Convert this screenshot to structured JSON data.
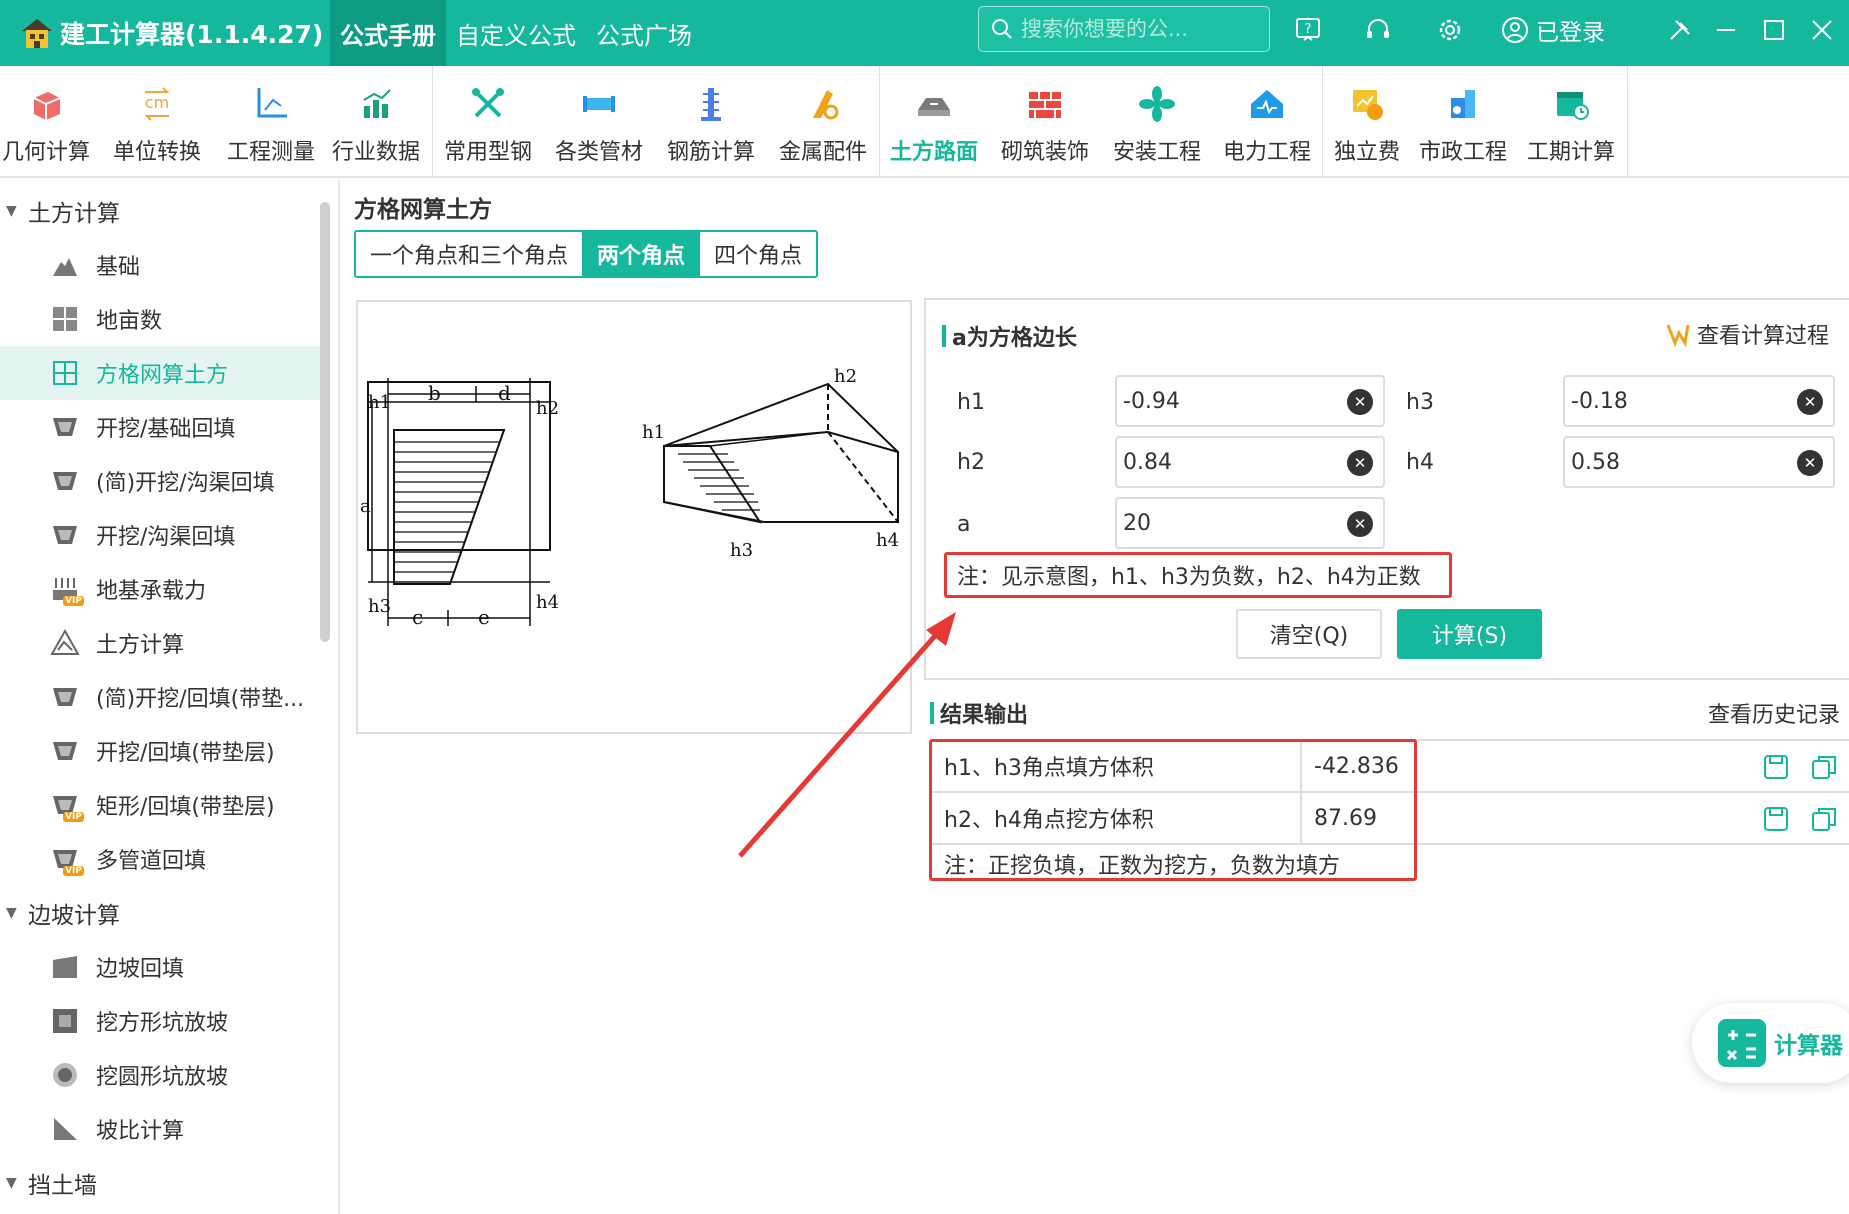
{
  "app": {
    "title": "建工计算器(1.1.4.27)"
  },
  "top_tabs": [
    {
      "label": "公式手册",
      "active": true
    },
    {
      "label": "自定义公式",
      "active": false
    },
    {
      "label": "公式广场",
      "active": false
    }
  ],
  "search": {
    "placeholder": "搜索你想要的公..."
  },
  "login": {
    "label": "已登录"
  },
  "toolbar": [
    {
      "label": "几何计算",
      "icon": "cube-icon"
    },
    {
      "label": "单位转换",
      "icon": "unit-convert-icon"
    },
    {
      "label": "工程测量",
      "icon": "survey-axis-icon"
    },
    {
      "label": "行业数据",
      "icon": "bar-chart-icon"
    },
    {
      "label": "常用型钢",
      "icon": "tools-icon"
    },
    {
      "label": "各类管材",
      "icon": "pipe-icon"
    },
    {
      "label": "钢筋计算",
      "icon": "rebar-icon"
    },
    {
      "label": "金属配件",
      "icon": "metal-fitting-icon"
    },
    {
      "label": "土方路面",
      "icon": "road-icon",
      "active": true
    },
    {
      "label": "砌筑装饰",
      "icon": "brick-wall-icon"
    },
    {
      "label": "安装工程",
      "icon": "fan-icon"
    },
    {
      "label": "电力工程",
      "icon": "power-house-icon"
    },
    {
      "label": "独立费",
      "icon": "fee-icon"
    },
    {
      "label": "市政工程",
      "icon": "municipal-icon"
    },
    {
      "label": "工期计算",
      "icon": "calendar-icon"
    }
  ],
  "sidebar": {
    "groups": [
      {
        "label": "土方计算",
        "items": [
          {
            "label": "基础",
            "icon": "foundation-icon"
          },
          {
            "label": "地亩数",
            "icon": "grid-plot-icon"
          },
          {
            "label": "方格网算土方",
            "icon": "grid-network-icon",
            "active": true
          },
          {
            "label": "开挖/基础回填",
            "icon": "trench-icon"
          },
          {
            "label": "(简)开挖/沟渠回填",
            "icon": "trench-icon"
          },
          {
            "label": "开挖/沟渠回填",
            "icon": "trench-icon"
          },
          {
            "label": "地基承载力",
            "icon": "bearing-icon",
            "vip": true
          },
          {
            "label": "土方计算",
            "icon": "triangle-warning-icon"
          },
          {
            "label": "(简)开挖/回填(带垫...",
            "icon": "trench-icon"
          },
          {
            "label": "开挖/回填(带垫层)",
            "icon": "trench-icon"
          },
          {
            "label": "矩形/回填(带垫层)",
            "icon": "trench-icon",
            "vip": true
          },
          {
            "label": "多管道回填",
            "icon": "trench-icon",
            "vip": true
          }
        ]
      },
      {
        "label": "边坡计算",
        "items": [
          {
            "label": "边坡回填",
            "icon": "slope-icon"
          },
          {
            "label": "挖方形坑放坡",
            "icon": "square-pit-icon"
          },
          {
            "label": "挖圆形坑放坡",
            "icon": "round-pit-icon"
          },
          {
            "label": "坡比计算",
            "icon": "slope-ratio-icon"
          }
        ]
      },
      {
        "label": "挡土墙",
        "items": []
      }
    ]
  },
  "main": {
    "section_title": "方格网算土方",
    "seg_tabs": [
      {
        "label": "一个角点和三个角点",
        "active": false
      },
      {
        "label": "两个角点",
        "active": true
      },
      {
        "label": "四个角点",
        "active": false
      }
    ],
    "form": {
      "heading": "a为方格边长",
      "view_process": "查看计算过程",
      "fields": [
        {
          "label": "h1",
          "value": "-0.94"
        },
        {
          "label": "h3",
          "value": "-0.18"
        },
        {
          "label": "h2",
          "value": "0.84"
        },
        {
          "label": "h4",
          "value": "0.58"
        },
        {
          "label": "a",
          "value": "20"
        }
      ],
      "note": "注：见示意图，h1、h3为负数，h2、h4为正数",
      "clear_label": "清空(Q)",
      "calc_label": "计算(S)"
    },
    "result": {
      "heading": "结果输出",
      "history": "查看历史记录",
      "rows": [
        {
          "label": "h1、h3角点填方体积",
          "value": "-42.836"
        },
        {
          "label": "h2、h4角点挖方体积",
          "value": "87.69"
        }
      ],
      "note": "注：正挖负填，正数为挖方，负数为填方"
    },
    "diagram_labels": {
      "b": "b",
      "d": "d",
      "c": "c",
      "e": "e",
      "a": "a",
      "h1": "h1",
      "h2": "h2",
      "h3": "h3",
      "h4": "h4"
    }
  },
  "float_calc": {
    "label": "计算器"
  },
  "colors": {
    "primary": "#15b89c",
    "highlight": "#e53935"
  }
}
